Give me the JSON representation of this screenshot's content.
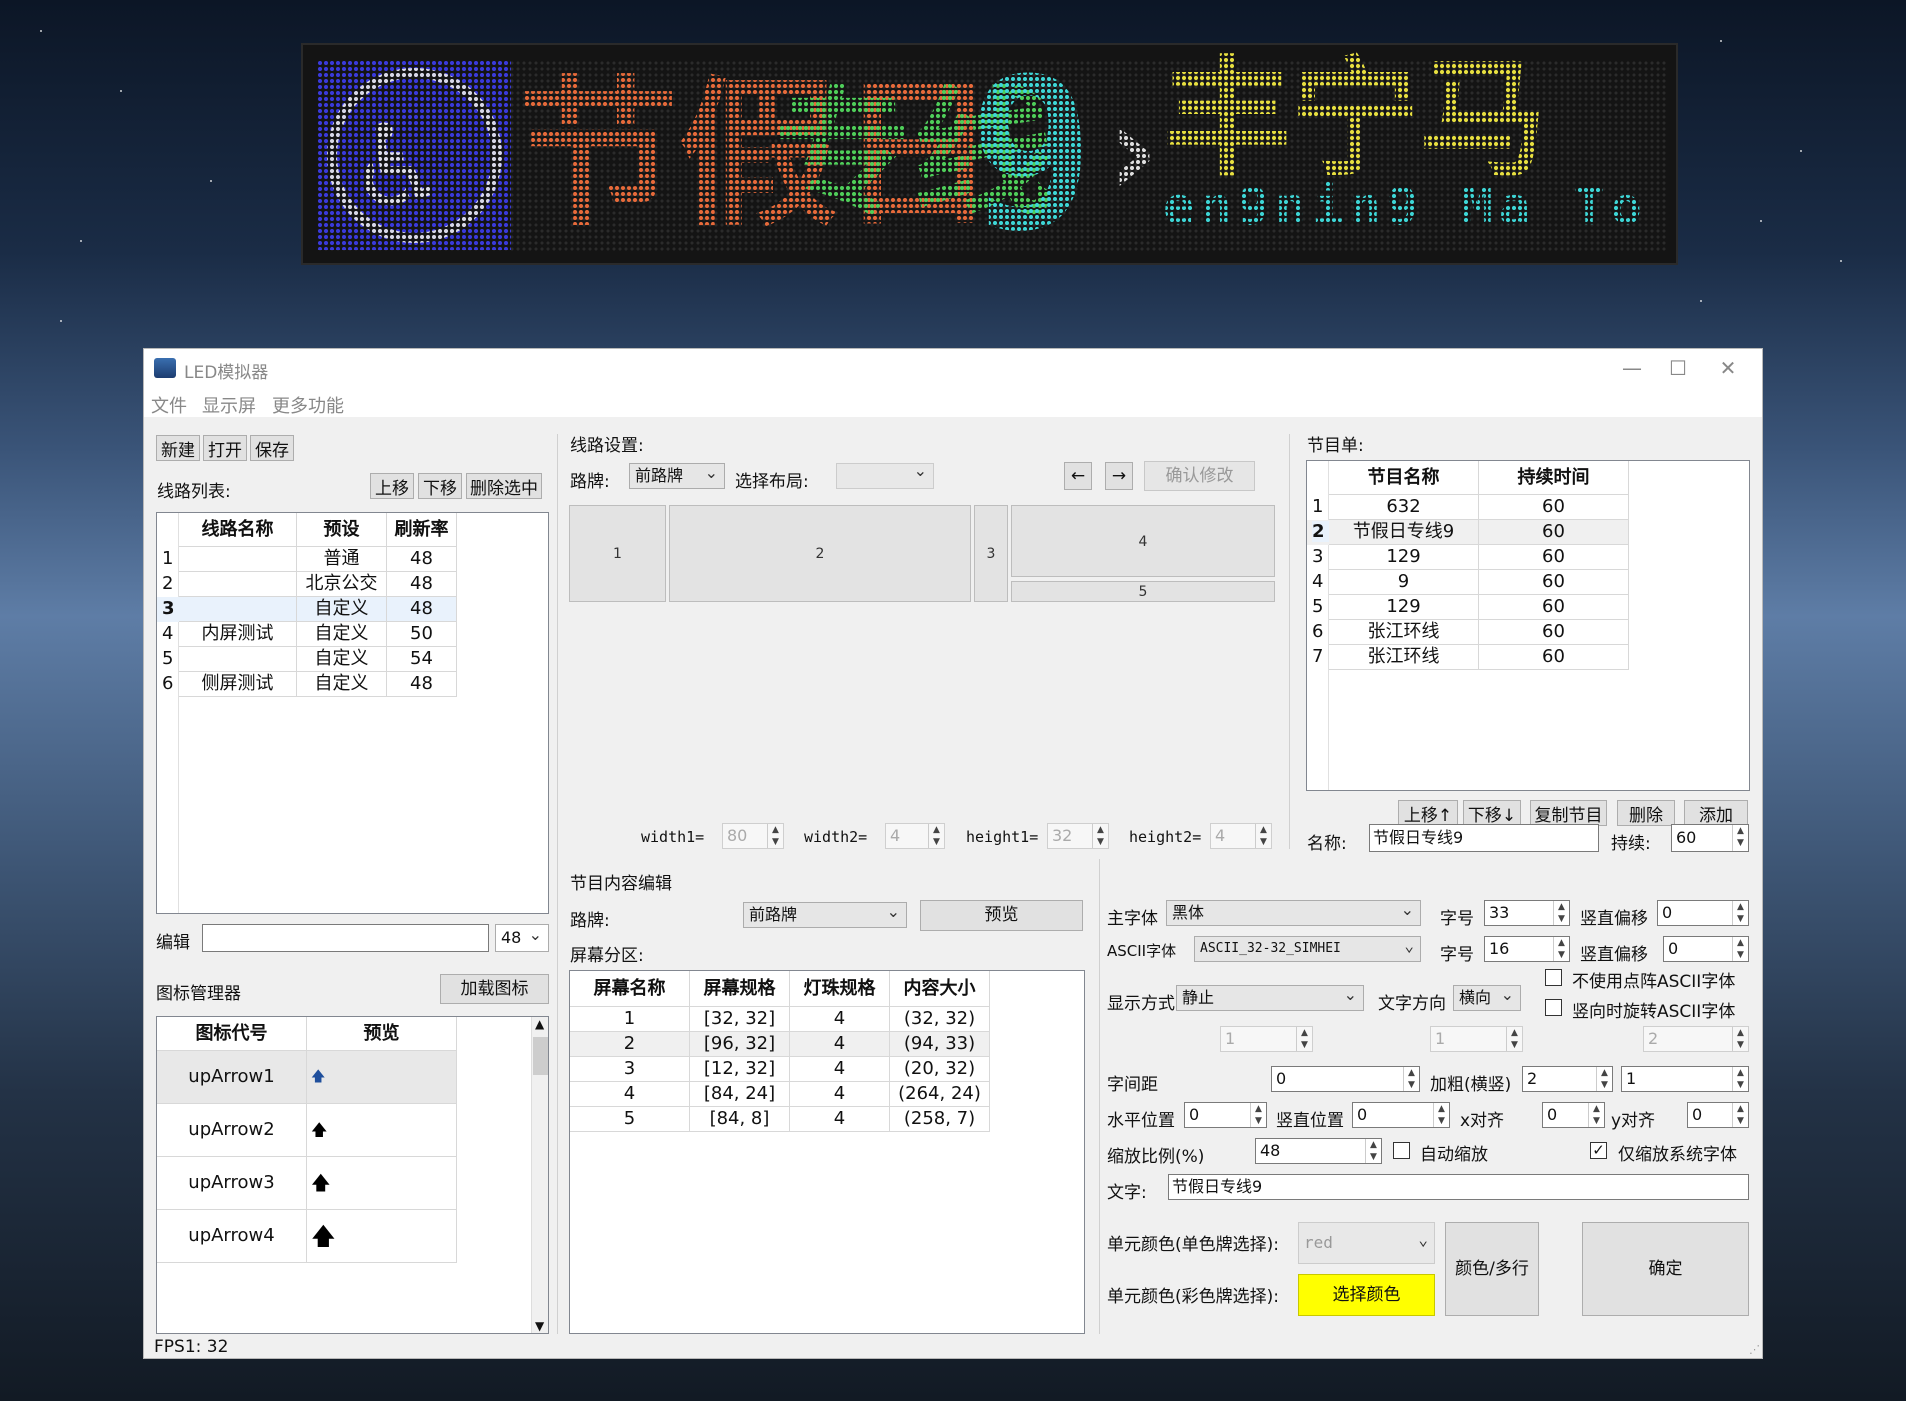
{
  "led": {
    "seg1": "节假日",
    "seg2": "专线",
    "seg3": "9",
    "seg4": "›",
    "seg5": "丰宁马",
    "seg6": "en9nin9 Ma To",
    "color_blue": "#3a3adc",
    "color_orange": "#e86a3a",
    "color_green": "#4fcf5a",
    "color_cyan": "#3ed7d7",
    "color_yellow": "#e8e040"
  },
  "window": {
    "title": "LED模拟器",
    "minimize": "—",
    "maximize": "☐",
    "close": "✕"
  },
  "menu": {
    "file": "文件",
    "screen": "显示屏",
    "more": "更多功能"
  },
  "left": {
    "new_btn": "新建",
    "open_btn": "打开",
    "save_btn": "保存",
    "line_list_label": "线路列表:",
    "up_btn": "上移",
    "down_btn": "下移",
    "delete_selected_btn": "删除选中",
    "table": {
      "headers": [
        "线路名称",
        "预设",
        "刷新率"
      ],
      "rows": [
        {
          "no": "1",
          "name": "",
          "preset": "普通",
          "rate": "48"
        },
        {
          "no": "2",
          "name": "",
          "preset": "北京公交",
          "rate": "48"
        },
        {
          "no": "3",
          "name": "",
          "preset": "自定义",
          "rate": "48"
        },
        {
          "no": "4",
          "name": "内屏测试",
          "preset": "自定义",
          "rate": "50"
        },
        {
          "no": "5",
          "name": "",
          "preset": "自定义",
          "rate": "54"
        },
        {
          "no": "6",
          "name": "侧屏测试",
          "preset": "自定义",
          "rate": "48"
        }
      ]
    },
    "edit_label": "编辑",
    "edit_value": "",
    "edit_combo": "48",
    "icon_manager_label": "图标管理器",
    "load_icon_btn": "加载图标",
    "icon_table": {
      "headers": [
        "图标代号",
        "预览"
      ],
      "rows": [
        {
          "code": "upArrow1",
          "preview": "🡅"
        },
        {
          "code": "upArrow2",
          "preview": "🡅"
        },
        {
          "code": "upArrow3",
          "preview": "🡅"
        },
        {
          "code": "upArrow4",
          "preview": "🡅"
        }
      ]
    }
  },
  "middle": {
    "line_settings_label": "线路设置:",
    "sign_label": "路牌:",
    "sign_value": "前路牌",
    "layout_label": "选择布局:",
    "layout_value": "",
    "left_arrow": "←",
    "right_arrow": "→",
    "confirm_btn": "确认修改",
    "zones": [
      "1",
      "2",
      "3",
      "4",
      "5"
    ],
    "width1_label": "width1=",
    "width1_value": "80",
    "width2_label": "width2=",
    "width2_value": "4",
    "height1_label": "height1=",
    "height1_value": "32",
    "height2_label": "height2=",
    "height2_value": "4",
    "content_edit_label": "节目内容编辑",
    "sign2_label": "路牌:",
    "sign2_value": "前路牌",
    "preview_btn": "预览",
    "partition_label": "屏幕分区:",
    "partition_table": {
      "headers": [
        "屏幕名称",
        "屏幕规格",
        "灯珠规格",
        "内容大小"
      ],
      "rows": [
        {
          "name": "1",
          "spec": "[32, 32]",
          "bead": "4",
          "size": "(32, 32)"
        },
        {
          "name": "2",
          "spec": "[96, 32]",
          "bead": "4",
          "size": "(94, 33)"
        },
        {
          "name": "3",
          "spec": "[12, 32]",
          "bead": "4",
          "size": "(20, 32)"
        },
        {
          "name": "4",
          "spec": "[84, 24]",
          "bead": "4",
          "size": "(264, 24)"
        },
        {
          "name": "5",
          "spec": "[84, 8]",
          "bead": "4",
          "size": "(258, 7)"
        }
      ]
    }
  },
  "right": {
    "program_list_label": "节目单:",
    "program_table": {
      "headers": [
        "节目名称",
        "持续时间"
      ],
      "rows": [
        {
          "no": "1",
          "name": "632",
          "dur": "60"
        },
        {
          "no": "2",
          "name": "节假日专线9",
          "dur": "60"
        },
        {
          "no": "3",
          "name": "129",
          "dur": "60"
        },
        {
          "no": "4",
          "name": "9",
          "dur": "60"
        },
        {
          "no": "5",
          "name": "129",
          "dur": "60"
        },
        {
          "no": "6",
          "name": "张江环线",
          "dur": "60"
        },
        {
          "no": "7",
          "name": "张江环线",
          "dur": "60"
        }
      ]
    },
    "up_btn": "上移↑",
    "down_btn": "下移↓",
    "copy_btn": "复制节目",
    "delete_btn": "删除",
    "add_btn": "添加",
    "name_label": "名称:",
    "name_value": "节假日专线9",
    "duration_label": "持续:",
    "duration_value": "60",
    "main_font_label": "主字体",
    "main_font_value": "黑体",
    "font_size_label": "字号",
    "font_size_value": "33",
    "v_offset_label": "竖直偏移",
    "v_offset_value": "0",
    "ascii_font_label": "ASCII字体",
    "ascii_font_value": "ASCII_32-32_SIMHEI",
    "ascii_size_label": "字号",
    "ascii_size_value": "16",
    "ascii_v_offset_label": "竖直偏移",
    "ascii_v_offset_value": "0",
    "no_dot_ascii_label": "不使用点阵ASCII字体",
    "display_mode_label": "显示方式",
    "display_mode_value": "静止",
    "text_dir_label": "文字方向",
    "text_dir_value": "横向",
    "rotate_ascii_label": "竖向时旋转ASCII字体",
    "dis_spin1": "1",
    "dis_spin2": "1",
    "dis_spin3": "2",
    "char_spacing_label": "字间距",
    "char_spacing_value": "0",
    "bold_label": "加粗(横竖)",
    "bold_h_value": "2",
    "bold_v_value": "1",
    "h_pos_label": "水平位置",
    "h_pos_value": "0",
    "v_pos_label": "竖直位置",
    "v_pos_value": "0",
    "x_align_label": "x对齐",
    "x_align_value": "0",
    "y_align_label": "y对齐",
    "y_align_value": "0",
    "scale_label": "缩放比例(%)",
    "scale_value": "48",
    "auto_scale_label": "自动缩放",
    "only_system_font_label": "仅缩放系统字体",
    "text_label": "文字:",
    "text_value": "节假日专线9",
    "mono_color_label": "单元颜色(单色牌选择):",
    "mono_color_value": "red",
    "color_color_label": "单元颜色(彩色牌选择):",
    "choose_color_btn": "选择颜色",
    "color_multiline_btn": "颜色/多行",
    "ok_btn": "确定"
  },
  "status": {
    "fps": "FPS1: 32"
  }
}
